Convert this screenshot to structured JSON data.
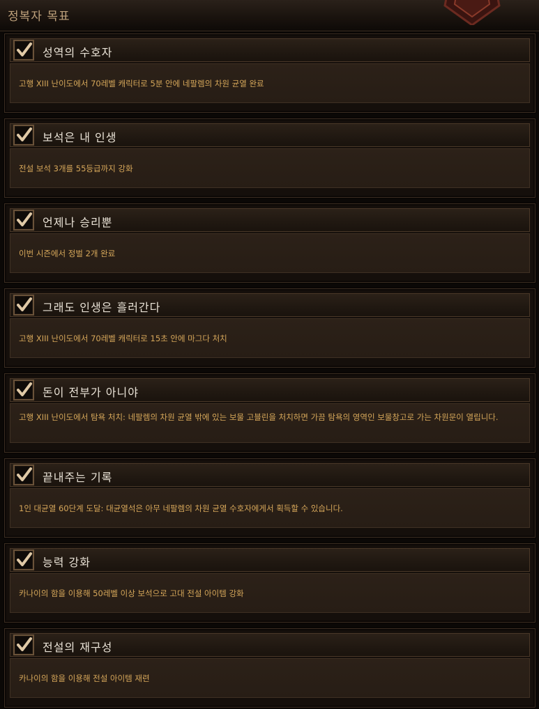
{
  "header": {
    "title": "정복자 목표"
  },
  "achievements": [
    {
      "title": "성역의 수호자",
      "description": "고행 XIII 난이도에서 70레벨 캐릭터로 5분 안에 네팔렘의 차원 균열 완료",
      "completed": true
    },
    {
      "title": "보석은 내 인생",
      "description": "전설 보석 3개를 55등급까지 강화",
      "completed": true
    },
    {
      "title": "언제나 승리뿐",
      "description": "이번 시즌에서 정벌 2개 완료",
      "completed": true
    },
    {
      "title": "그래도 인생은 흘러간다",
      "description": "고행 XIII 난이도에서 70레벨 캐릭터로 15초 안에 마그다 처치",
      "completed": true
    },
    {
      "title": "돈이 전부가 아니야",
      "description": "고행 XIII 난이도에서 탐욕 처치: 네팔렘의 차원 균열 밖에 있는 보물 고블린을 처치하면 가끔 탐욕의 영역인 보물창고로 가는 차원문이 열립니다.",
      "completed": true
    },
    {
      "title": "끝내주는 기록",
      "description": "1인 대균열 60단계 도달: 대균열석은 아무 네팔렘의 차원 균열 수호자에게서 획득할 수 있습니다.",
      "completed": true
    },
    {
      "title": "능력 강화",
      "description": "카나이의 함을 이용해 50레벨 이상 보석으로 고대 전설 아이템 강화",
      "completed": true
    },
    {
      "title": "전설의 재구성",
      "description": "카나이의 함을 이용해 전설 아이템 재련",
      "completed": true
    }
  ],
  "colors": {
    "title": "#e9e2d6",
    "description": "#d6a75a",
    "header": "#bfa27c",
    "check": "#e0c9a6"
  }
}
